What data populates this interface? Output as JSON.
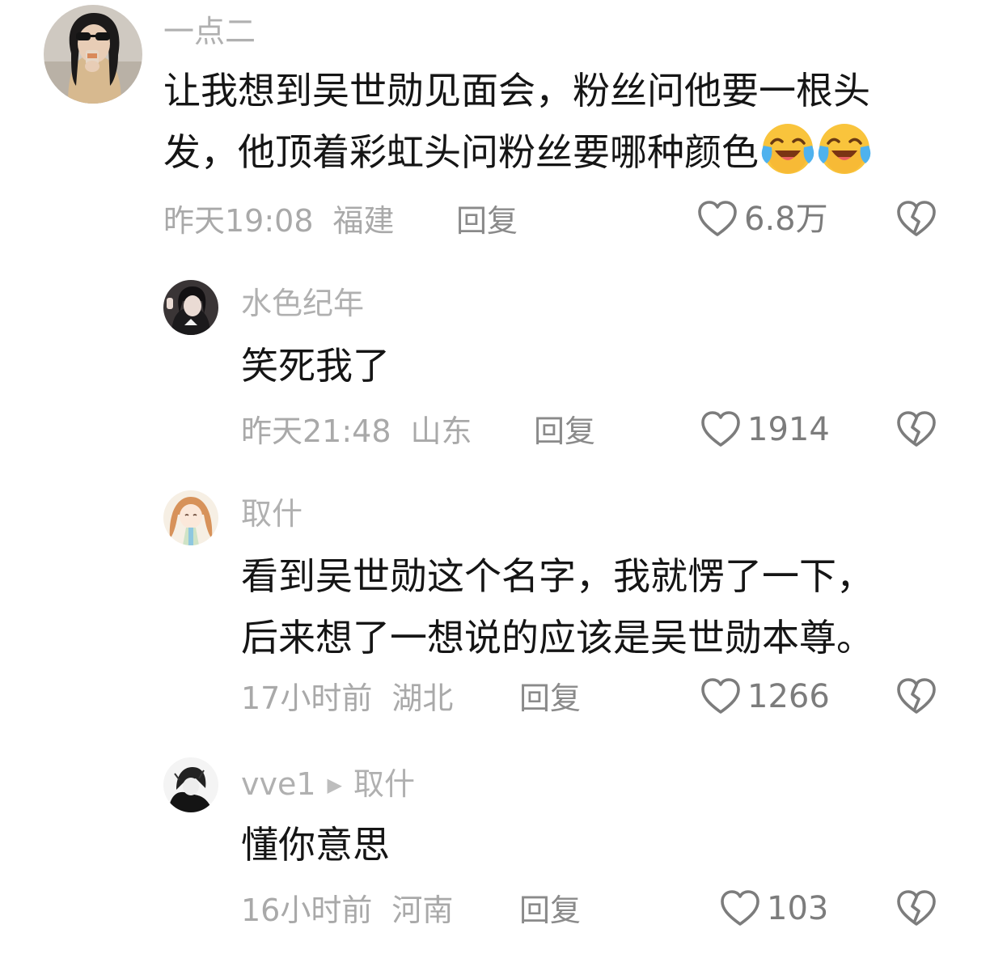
{
  "comments": [
    {
      "username": "一点二",
      "text_lines": [
        "让我想到吴世勋见面会，粉丝问他要一根头",
        "发，他顶着彩虹头问粉丝要哪种颜色"
      ],
      "emojis": [
        "laugh-cry-emoji",
        "laugh-cry-emoji"
      ],
      "time": "昨天19:08",
      "location": "福建",
      "reply_label": "回复",
      "likes": "6.8万"
    },
    {
      "username": "水色纪年",
      "text_lines": [
        "笑死我了"
      ],
      "time": "昨天21:48",
      "location": "山东",
      "reply_label": "回复",
      "likes": "1914"
    },
    {
      "username": "取什",
      "text_lines": [
        "看到吴世勋这个名字，我就愣了一下，",
        "后来想了一想说的应该是吴世勋本尊。"
      ],
      "time": "17小时前",
      "location": "湖北",
      "reply_label": "回复",
      "likes": "1266"
    },
    {
      "username": "vve1",
      "reply_to": "取什",
      "text_lines": [
        "懂你意思"
      ],
      "time": "16小时前",
      "location": "河南",
      "reply_label": "回复",
      "likes": "103"
    }
  ],
  "icons": {
    "like": "heart-outline-icon",
    "dislike": "broken-heart-icon",
    "reply_arrow": "play-triangle-icon"
  },
  "colors": {
    "text": "#151515",
    "muted": "#a9a9a9",
    "icon": "#7c7c7c"
  }
}
